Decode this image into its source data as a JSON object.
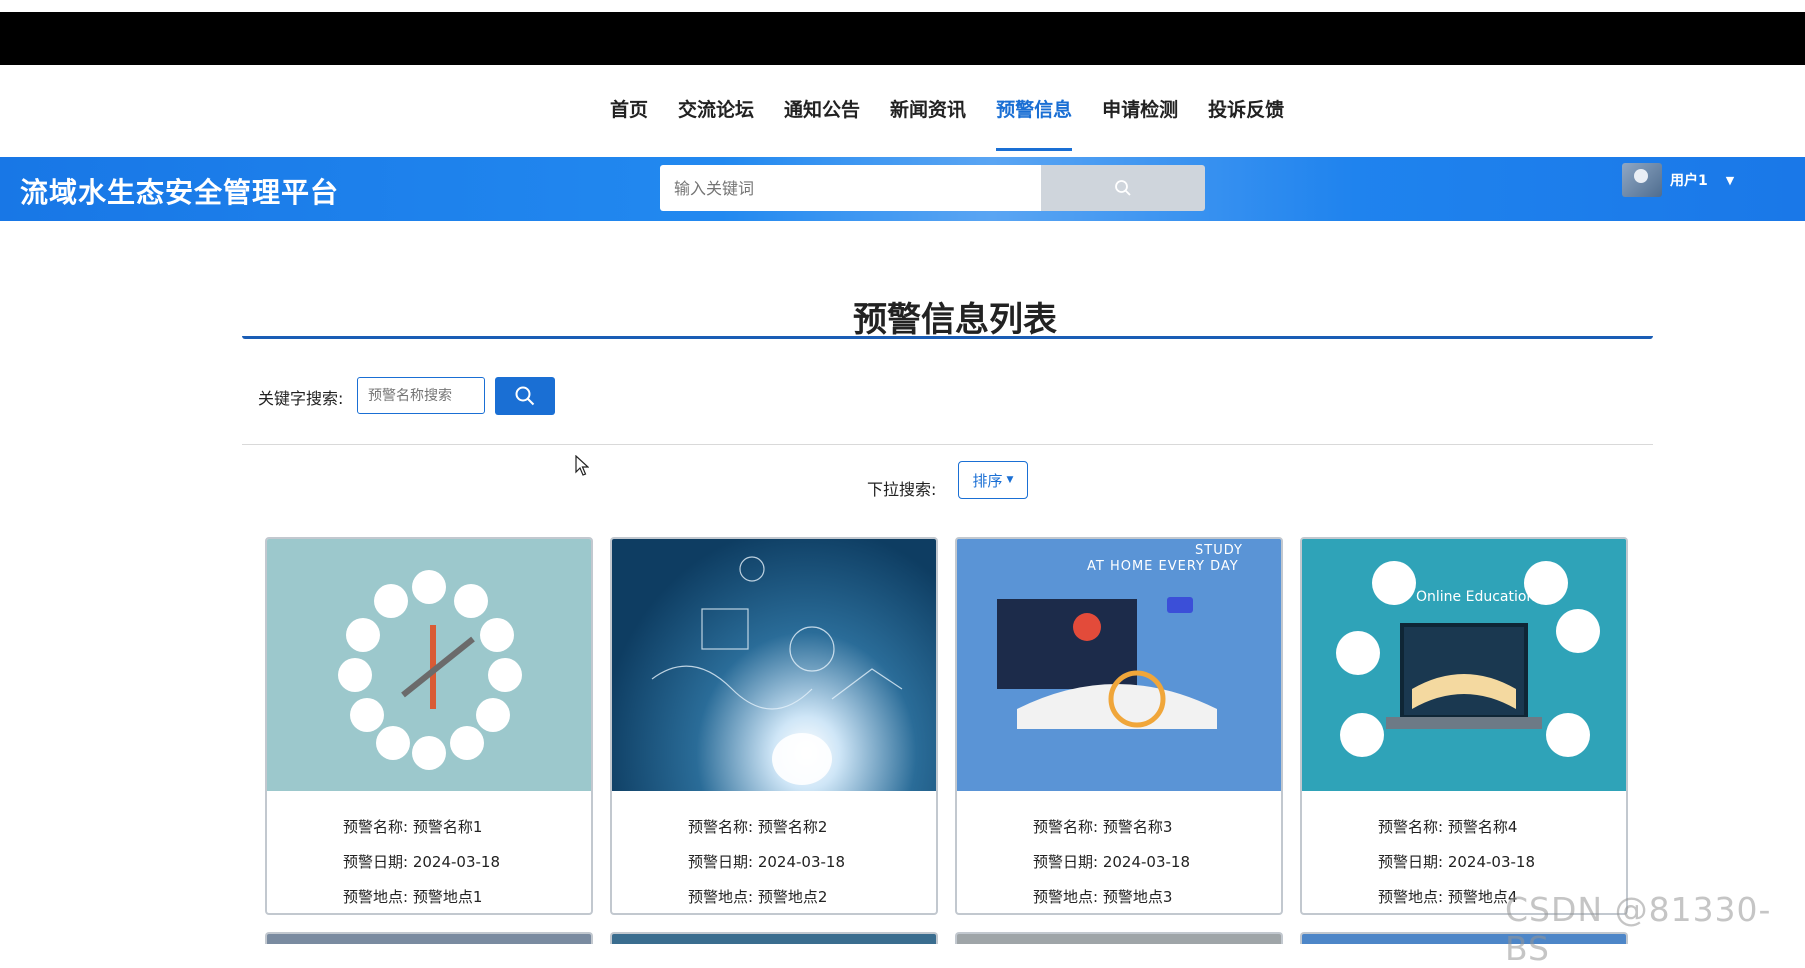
{
  "nav": {
    "items": [
      {
        "label": "首页"
      },
      {
        "label": "交流论坛"
      },
      {
        "label": "通知公告"
      },
      {
        "label": "新闻资讯"
      },
      {
        "label": "预警信息"
      },
      {
        "label": "申请检测"
      },
      {
        "label": "投诉反馈"
      }
    ],
    "active_index": 4
  },
  "header": {
    "platform_title": "流域水生态安全管理平台",
    "search_placeholder": "输入关键词",
    "user_name": "用户1"
  },
  "main": {
    "title": "预警信息列表",
    "keyword_label": "关键字搜索:",
    "keyword_placeholder": "预警名称搜索",
    "dropdown_label": "下拉搜索:",
    "sort_label": "排序"
  },
  "cards": [
    {
      "name": "预警名称: 预警名称1",
      "date": "预警日期: 2024-03-18",
      "location": "预警地点: 预警地点1"
    },
    {
      "name": "预警名称: 预警名称2",
      "date": "预警日期: 2024-03-18",
      "location": "预警地点: 预警地点2"
    },
    {
      "name": "预警名称: 预警名称3",
      "date": "预警日期: 2024-03-18",
      "location": "预警地点: 预警地点3",
      "image_text": [
        "STUDY",
        "AT HOME EVERY DAY"
      ]
    },
    {
      "name": "预警名称: 预警名称4",
      "date": "预警日期: 2024-03-18",
      "location": "预警地点: 预警地点4",
      "image_text": [
        "Online Education"
      ]
    }
  ],
  "watermark": "CSDN @81330-BS",
  "colors": {
    "accent": "#1a6fd4",
    "header_blue": "#1877e6",
    "nav_active": "#1a6fd4"
  }
}
